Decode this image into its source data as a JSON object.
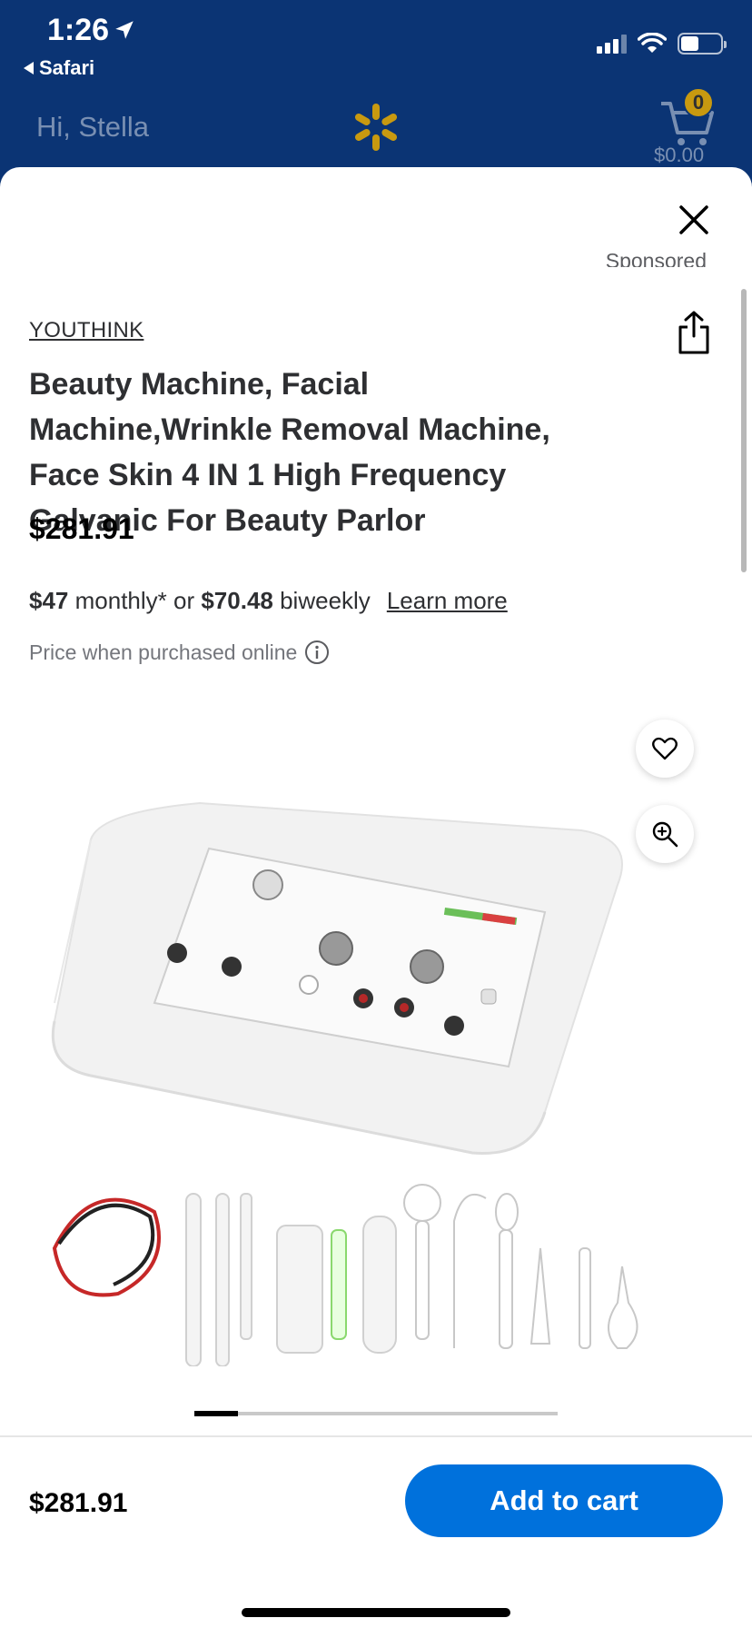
{
  "status_bar": {
    "time": "1:26",
    "back_app": "Safari",
    "icons": [
      "location-arrow-icon",
      "signal-icon",
      "wifi-icon",
      "battery-icon"
    ],
    "battery_level": 0.45
  },
  "header": {
    "greeting": "Hi, Stella",
    "logo": "walmart-spark-icon",
    "cart_count": "0",
    "cart_total": "$0.00"
  },
  "sheet": {
    "sponsored": "Sponsored",
    "brand": "YOUTHINK",
    "title": "Beauty Machine, Facial Machine,Wrinkle Removal Machine, Face Skin 4 IN 1 High Frequency Galvanic For Beauty Parlor",
    "price": "$281.91",
    "financing": {
      "monthly_amount": "$47",
      "monthly_text": " monthly* or ",
      "biweekly_amount": "$70.48",
      "biweekly_text": " biweekly",
      "learn_more": "Learn more"
    },
    "price_note": "Price when purchased online",
    "carousel_position": 0.12
  },
  "bottom_bar": {
    "price": "$281.91",
    "add_to_cart": "Add to cart"
  },
  "colors": {
    "header_bg": "#0b3474",
    "spark": "#c89910",
    "primary_button": "#0071dc"
  }
}
